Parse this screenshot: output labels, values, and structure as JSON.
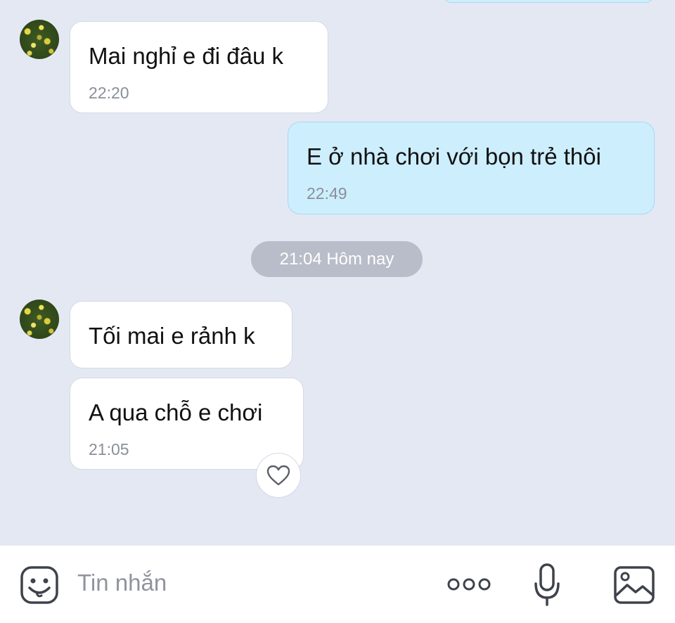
{
  "messages": [
    {
      "text": "Mai nghỉ e đi đâu k",
      "time": "22:20"
    },
    {
      "text": "E ở nhà chơi với bọn trẻ thôi",
      "time": "22:49"
    },
    {
      "text": "Tối mai e rảnh k"
    },
    {
      "text": "A qua chỗ e chơi",
      "time": "21:05"
    }
  ],
  "date_separator": "21:04 Hôm nay",
  "composer": {
    "placeholder": "Tin nhắn",
    "icons": [
      "sticker-icon",
      "more-icon",
      "microphone-icon",
      "image-icon"
    ]
  },
  "colors": {
    "background": "#e3e8f3",
    "incoming_bubble": "#ffffff",
    "outgoing_bubble": "#cdeefd",
    "date_pill": "#b8bdc9"
  }
}
